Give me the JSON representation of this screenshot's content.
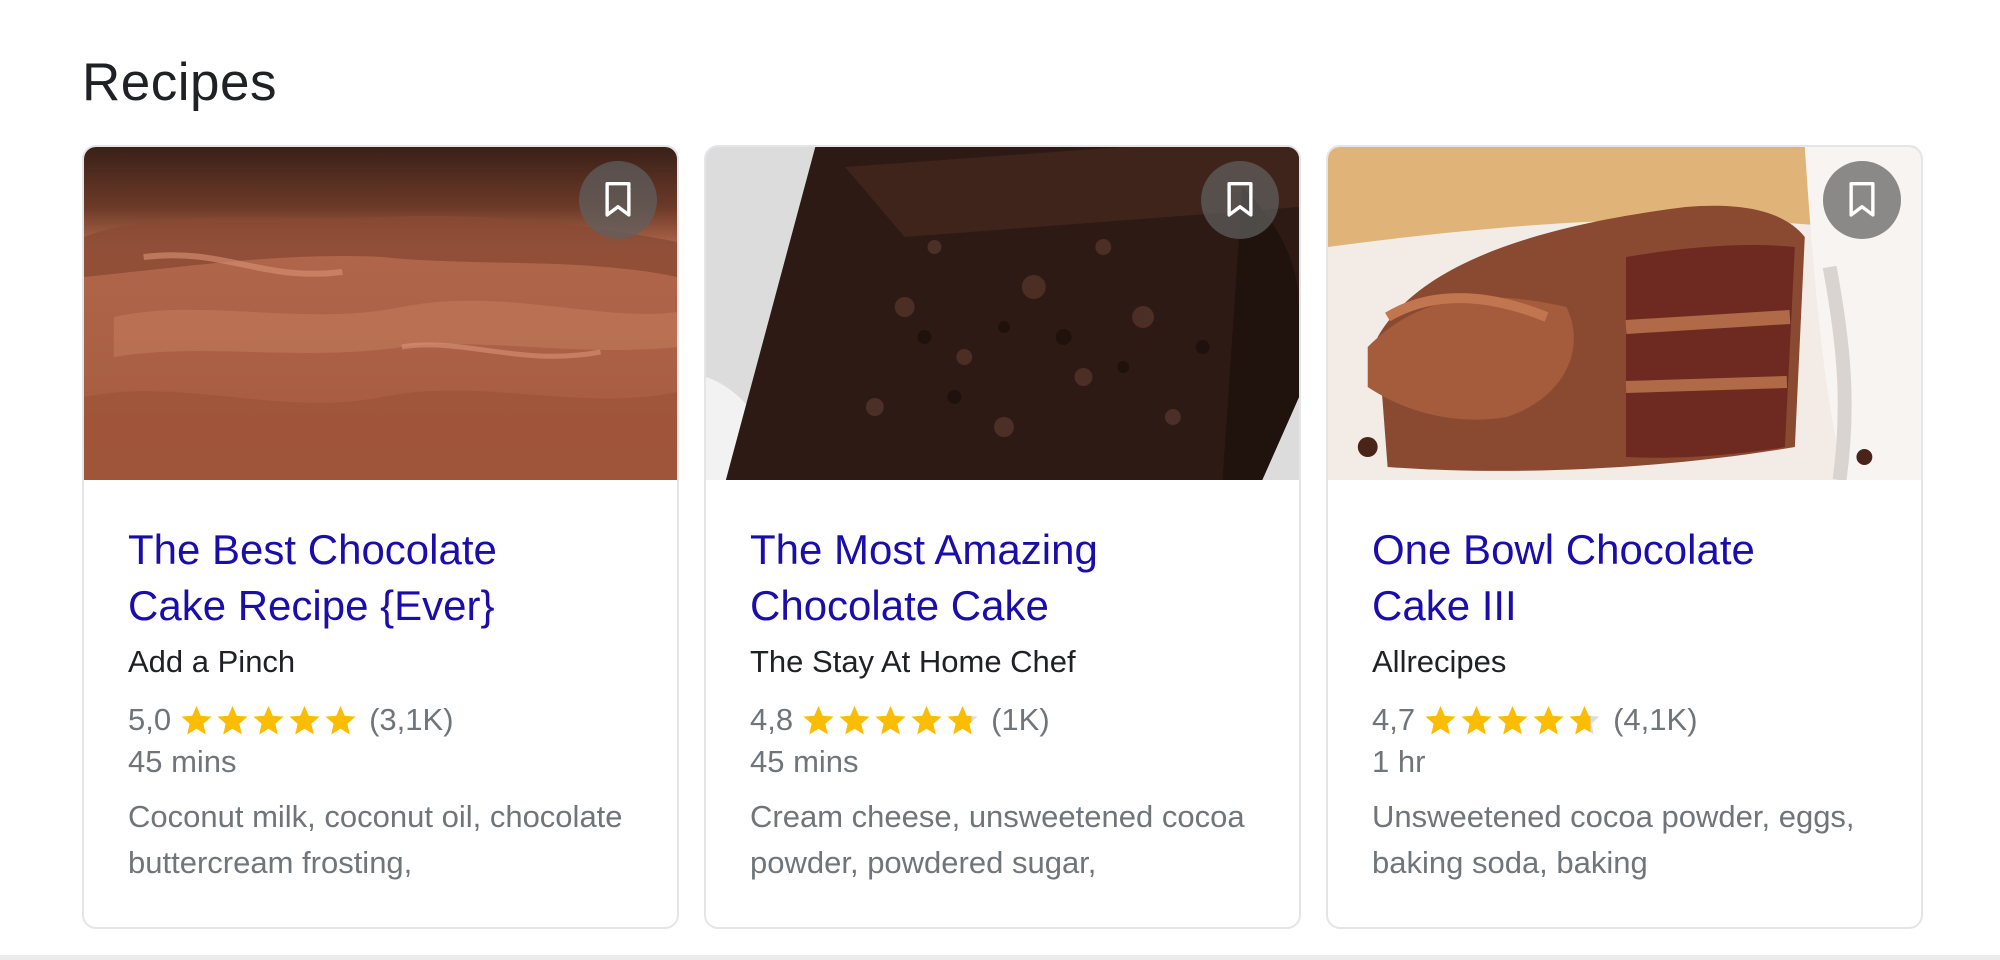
{
  "section": {
    "title": "Recipes"
  },
  "cards": [
    {
      "title": "The Best Chocolate Cake Recipe {Ever}",
      "source": "Add a Pinch",
      "rating": "5,0",
      "stars": 5.0,
      "reviews": "(3,1K)",
      "time": "45 mins",
      "ingredients": "Coconut milk, coconut oil, chocolate buttercream frosting,",
      "save_icon": "bookmark-icon"
    },
    {
      "title": "The Most Amazing Chocolate Cake",
      "source": "The Stay At Home Chef",
      "rating": "4,8",
      "stars": 4.8,
      "reviews": "(1K)",
      "time": "45 mins",
      "ingredients": "Cream cheese, unsweetened cocoa powder, powdered sugar,",
      "save_icon": "bookmark-icon"
    },
    {
      "title": "One Bowl Chocolate Cake III",
      "source": "Allrecipes",
      "rating": "4,7",
      "stars": 4.7,
      "reviews": "(4,1K)",
      "time": "1 hr",
      "ingredients": "Unsweetened cocoa powder, eggs, baking soda, baking",
      "save_icon": "bookmark-icon"
    }
  ],
  "colors": {
    "link": "#1a0dab",
    "meta": "#70757a",
    "star": "#fbbc04",
    "star_empty": "#dadce0"
  }
}
